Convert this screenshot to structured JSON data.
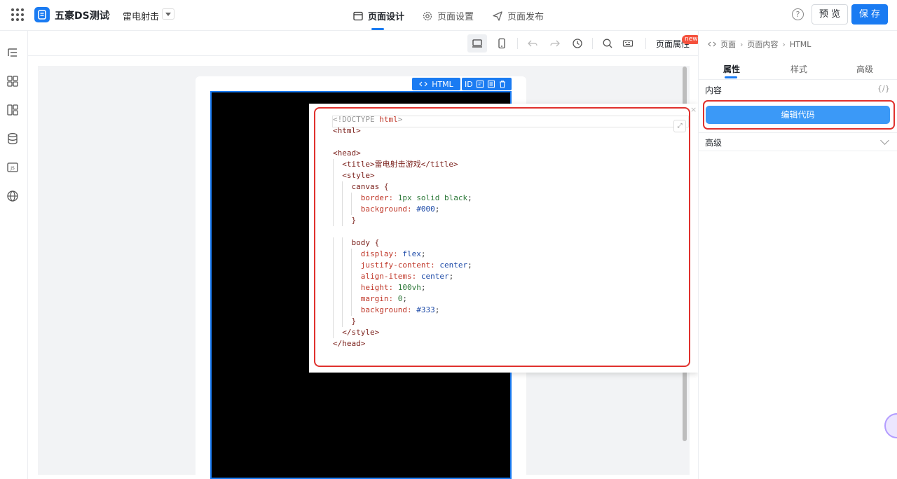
{
  "header": {
    "app_name": "五豪DS测试",
    "breadcrumb_arrow": "›",
    "page_name": "雷电射击",
    "tabs": [
      {
        "label": "页面设计"
      },
      {
        "label": "页面设置"
      },
      {
        "label": "页面发布"
      }
    ],
    "help": "?",
    "preview_label": "预 览",
    "save_label": "保 存"
  },
  "toolbar": {
    "page_attr_label": "页面属性",
    "new_badge": "new"
  },
  "element_tags": {
    "html_label": "HTML",
    "id_label": "ID"
  },
  "code_editor": {
    "lines": [
      "<!DOCTYPE html>",
      "<html>",
      "",
      "<head>",
      "  <title>雷电射击游戏</title>",
      "  <style>",
      "    canvas {",
      "      border: 1px solid black;",
      "      background: #000;",
      "    }",
      "",
      "    body {",
      "      display: flex;",
      "      justify-content: center;",
      "      align-items: center;",
      "      height: 100vh;",
      "      margin: 0;",
      "      background: #333;",
      "    }",
      "  </style>",
      "</head>"
    ],
    "expand_icon": "⤢",
    "close": "×"
  },
  "right_panel": {
    "breadcrumb": [
      "页面",
      "页面内容",
      "HTML"
    ],
    "tabs": [
      "属性",
      "样式",
      "高级"
    ],
    "content_title": "内容",
    "braces": "{/}",
    "edit_code_label": "编辑代码",
    "advanced_title": "高级"
  },
  "colors": {
    "accent": "#1a7bf2",
    "highlight_border": "#e0312d",
    "edit_button": "#3b99f7"
  }
}
